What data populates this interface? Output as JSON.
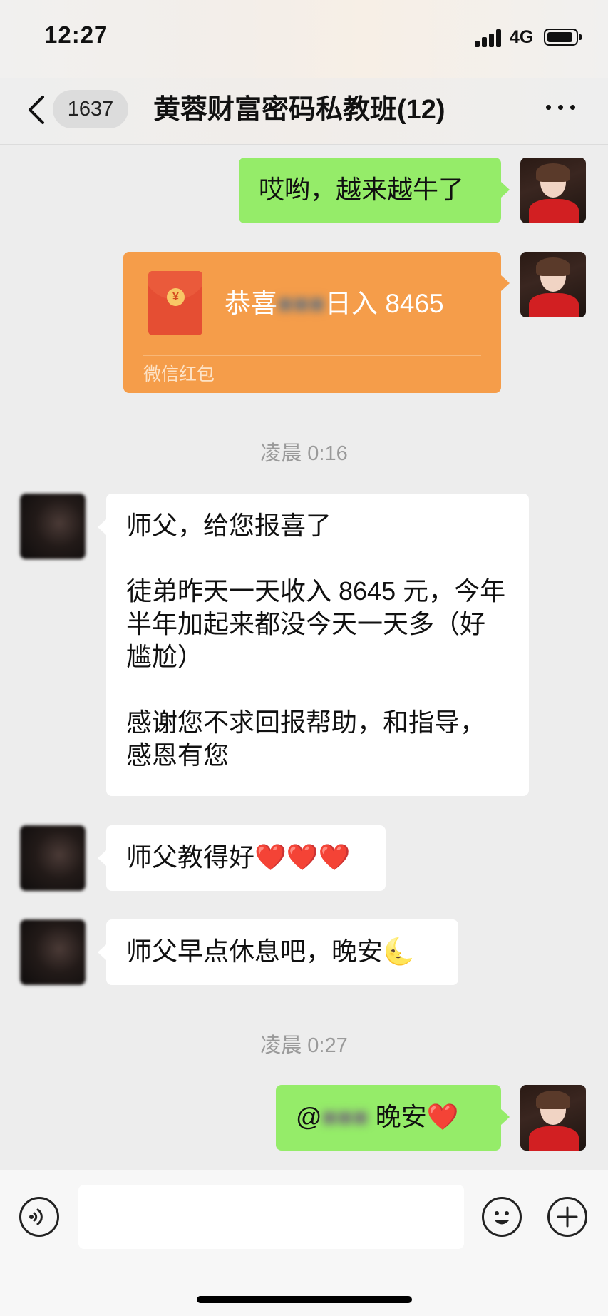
{
  "status_bar": {
    "time": "12:27",
    "network": "4G"
  },
  "nav": {
    "back_count": "1637",
    "title": "黄蓉财富密码私教班(12)"
  },
  "messages": {
    "m1": "哎哟，越来越牛了",
    "packet": {
      "prefix": "恭喜",
      "name_blurred": "■■■",
      "suffix": "日入 8465",
      "label": "微信红包"
    },
    "ts1": "凌晨 0:16",
    "m2": "师父，给您报喜了\n\n徒弟昨天一天收入 8645 元，今年半年加起来都没今天一天多（好尴尬）\n\n感谢您不求回报帮助，和指导，感恩有您",
    "m3": "师父教得好❤️❤️❤️",
    "m4_text": "师父早点休息吧，晚安",
    "m4_emoji": "🌜",
    "ts2": "凌晨 0:27",
    "m5": {
      "at": "@",
      "name_blurred": "■■■",
      "text": " 晚安❤️"
    }
  },
  "icons": {
    "back": "back-chevron-icon",
    "more": "more-icon",
    "voice": "voice-icon",
    "emoji": "emoji-icon",
    "plus": "plus-icon"
  },
  "colors": {
    "outgoing_bubble": "#95ec69",
    "incoming_bubble": "#ffffff",
    "red_packet": "#f59d4a"
  }
}
